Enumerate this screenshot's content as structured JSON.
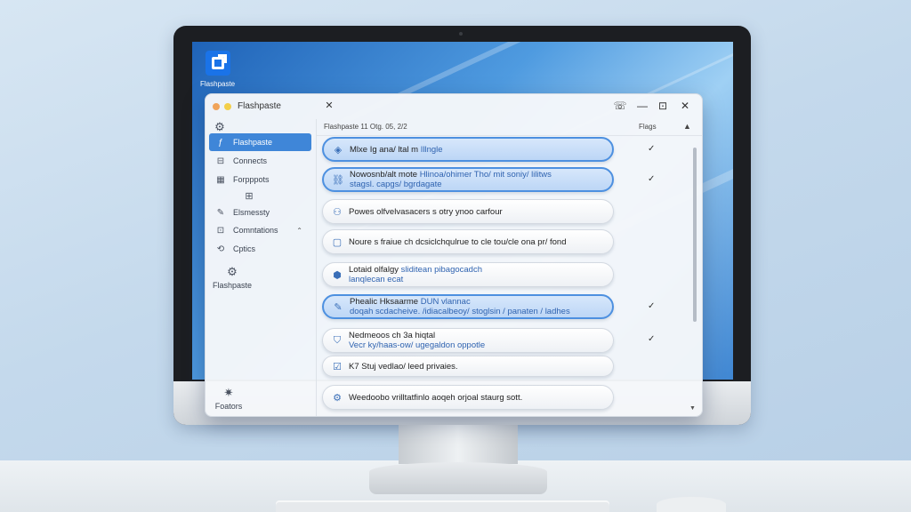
{
  "desktop": {
    "icon_label": "Flashpaste"
  },
  "window": {
    "title": "Flashpaste",
    "tab_close": "✕",
    "controls": {
      "phone": "☏",
      "minimize": "—",
      "restore": "⊡",
      "close": "✕"
    }
  },
  "sidebar": {
    "top_icon": "⚙",
    "items": [
      {
        "label": "Flashpaste",
        "icon": "flash-icon"
      },
      {
        "label": "Connects",
        "icon": "link-icon"
      },
      {
        "label": "Forpppots",
        "icon": "grid-icon"
      },
      {
        "label": "Elsmessty",
        "icon": "pencil-icon"
      },
      {
        "label": "Comntations",
        "icon": "settings-icon"
      },
      {
        "label": "Cptics",
        "icon": "gear-icon"
      },
      {
        "label": "Flashpaste",
        "icon": "settings-gear-icon"
      },
      {
        "label": "Foators",
        "icon": "tools-icon"
      }
    ]
  },
  "content": {
    "header_date": "Flashpaste 11 Otg. 05, 2/2",
    "header_flags": "Flags",
    "rows": [
      {
        "icon": "shield-icon",
        "text": "Mlxe Ig ana/ ltal m",
        "text_link": "Illngle",
        "highlighted": true,
        "checked": true
      },
      {
        "icon": "link-icon",
        "text": "Nowosnb/alt mote",
        "text_link": "Hlinoa/ohimer Tho/ mit soniy/ lilitws",
        "line2": "stagsl. capgs/ bgrdagate",
        "highlighted": true,
        "checked": true
      },
      {
        "icon": "person-icon",
        "text": "Powes olfvelvasacers s otry ynoo carfour",
        "highlighted": false,
        "checked": false
      },
      {
        "icon": "clipboard-icon",
        "text": "Noure s fraiue ch dcsiclchqulrue to cle tou/cle ona pr/ fond",
        "highlighted": false,
        "checked": false
      },
      {
        "icon": "location-icon",
        "text": "Lotaid olfalgy",
        "text_link": "sliditean pibagocadch",
        "line2": "lanqlecan ecat",
        "highlighted": false,
        "checked": false
      },
      {
        "icon": "pencil-icon",
        "text": "Phealic Hksaarme",
        "text_link": "DUN vlannac",
        "line2": "doqah scdacheive. /idiacalbeoy/ stoglsin / panaten / ladhes",
        "highlighted": true,
        "checked": true
      },
      {
        "icon": "shield-check-icon",
        "text": "Nedmeoos ch 3a hiqtal",
        "line2": "Vecr ky/haas-ow/ ugegaldon oppotle",
        "highlighted": false,
        "checked": true
      },
      {
        "icon": "check-shield-icon",
        "text": "K7 Stuj vedlao/ leed privaies.",
        "highlighted": false,
        "checked": false
      },
      {
        "icon": "gear-icon",
        "text": "Weedoobo vrilltatfinlo aoqeh orjoal staurg sott.",
        "highlighted": false,
        "checked": false
      }
    ]
  },
  "glyphs": {
    "check": "✓",
    "scroll_up": "▲",
    "scroll_down": "▼",
    "chevron_up": "⌃",
    "chevron_down": "⌄"
  }
}
